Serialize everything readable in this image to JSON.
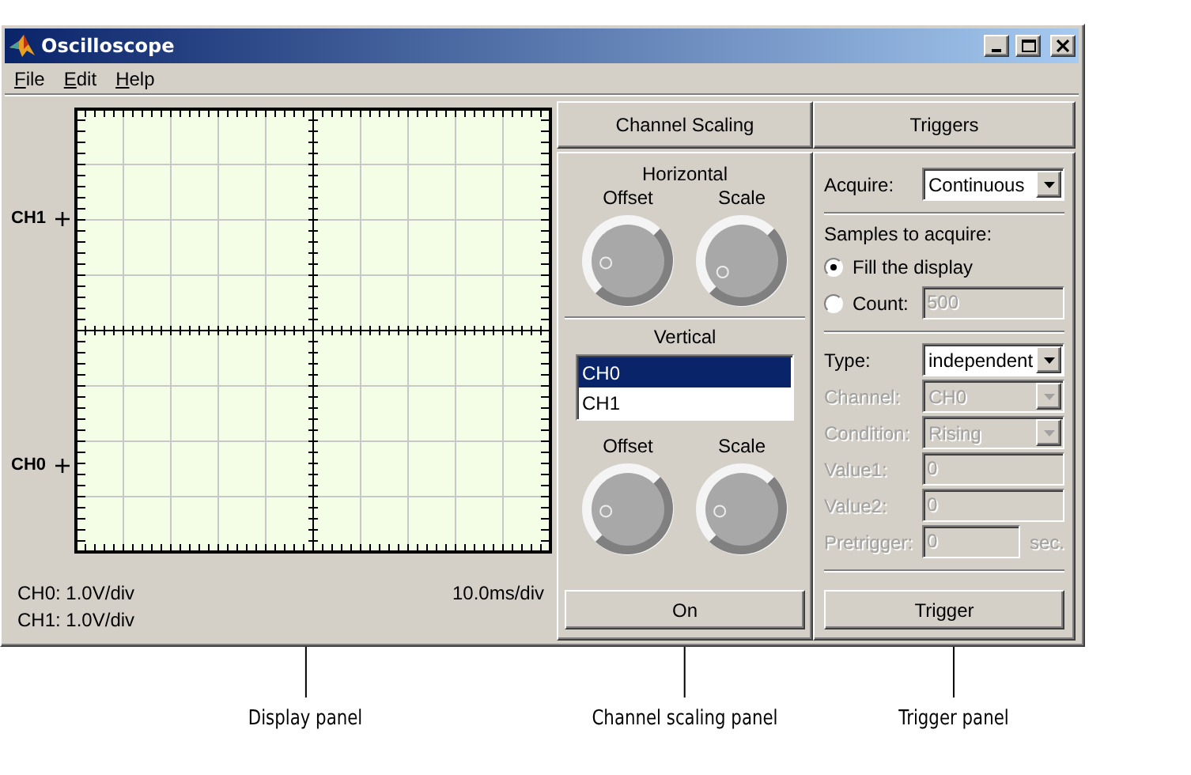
{
  "window": {
    "title": "Oscilloscope"
  },
  "menu": [
    {
      "label": "File"
    },
    {
      "label": "Edit"
    },
    {
      "label": "Help"
    }
  ],
  "display": {
    "channel_markers": [
      {
        "label": "CH1"
      },
      {
        "label": "CH0"
      }
    ],
    "scale_readouts": [
      "CH0: 1.0V/div",
      "CH1: 1.0V/div"
    ],
    "time_readout": "10.0ms/div"
  },
  "channel_scaling": {
    "header": "Channel Scaling",
    "horizontal": {
      "title": "Horizontal",
      "knobs": [
        {
          "label": "Offset"
        },
        {
          "label": "Scale"
        }
      ]
    },
    "vertical": {
      "title": "Vertical",
      "channels": [
        {
          "label": "CH0",
          "selected": true
        },
        {
          "label": "CH1",
          "selected": false
        }
      ],
      "knobs": [
        {
          "label": "Offset"
        },
        {
          "label": "Scale"
        }
      ]
    },
    "button": "On"
  },
  "triggers": {
    "header": "Triggers",
    "acquire": {
      "label": "Acquire:",
      "value": "Continuous"
    },
    "samples_label": "Samples to acquire:",
    "sample_options": [
      {
        "label": "Fill the display",
        "selected": true
      },
      {
        "label": "Count:",
        "selected": false,
        "value": "500"
      }
    ],
    "fields": [
      {
        "label": "Type:",
        "value": "independent",
        "kind": "dropdown",
        "disabled": false
      },
      {
        "label": "Channel:",
        "value": "CH0",
        "kind": "dropdown",
        "disabled": true
      },
      {
        "label": "Condition:",
        "value": "Rising",
        "kind": "dropdown",
        "disabled": true
      },
      {
        "label": "Value1:",
        "value": "0",
        "kind": "text",
        "disabled": true
      },
      {
        "label": "Value2:",
        "value": "0",
        "kind": "text",
        "disabled": true
      },
      {
        "label": "Pretrigger:",
        "value": "0",
        "kind": "text",
        "disabled": true,
        "unit": "sec."
      }
    ],
    "button": "Trigger"
  },
  "callouts": [
    {
      "label": "Display panel"
    },
    {
      "label": "Channel scaling panel"
    },
    {
      "label": "Trigger panel"
    }
  ]
}
